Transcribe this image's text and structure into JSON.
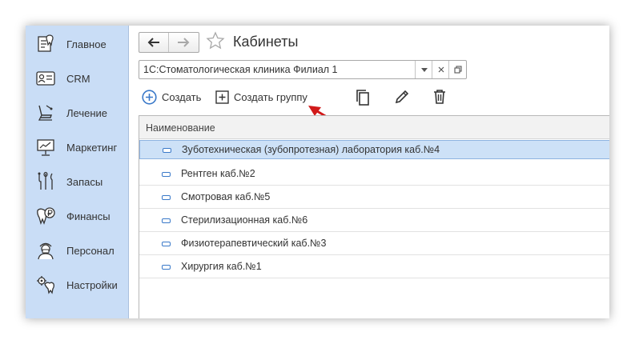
{
  "sidebar": {
    "items": [
      {
        "label": "Главное",
        "icon": "home-tooth-icon"
      },
      {
        "label": "CRM",
        "icon": "id-card-icon"
      },
      {
        "label": "Лечение",
        "icon": "dental-chair-icon"
      },
      {
        "label": "Маркетинг",
        "icon": "presentation-board-icon"
      },
      {
        "label": "Запасы",
        "icon": "dental-tools-icon"
      },
      {
        "label": "Финансы",
        "icon": "tooth-ruble-icon"
      },
      {
        "label": "Персонал",
        "icon": "doctor-icon"
      },
      {
        "label": "Настройки",
        "icon": "tooth-gear-icon"
      }
    ]
  },
  "header": {
    "title": "Кабинеты"
  },
  "filter": {
    "value": "1С:Стоматологическая клиника Филиал 1"
  },
  "toolbar": {
    "create_label": "Создать",
    "create_group_label": "Создать группу"
  },
  "table": {
    "column": "Наименование",
    "rows": [
      "Зуботехническая (зубопротезная) лаборатория каб.№4",
      "Рентген каб.№2",
      "Смотровая каб.№5",
      "Стерилизационная каб.№6",
      "Физиотерапевтический каб.№3",
      "Хирургия каб.№1"
    ],
    "selected_index": 0
  },
  "colors": {
    "sidebar_bg": "#c9ddf6",
    "accent_blue": "#3a79c9",
    "selection": "#cde1f7",
    "annotation_arrow": "#d11a1a"
  }
}
